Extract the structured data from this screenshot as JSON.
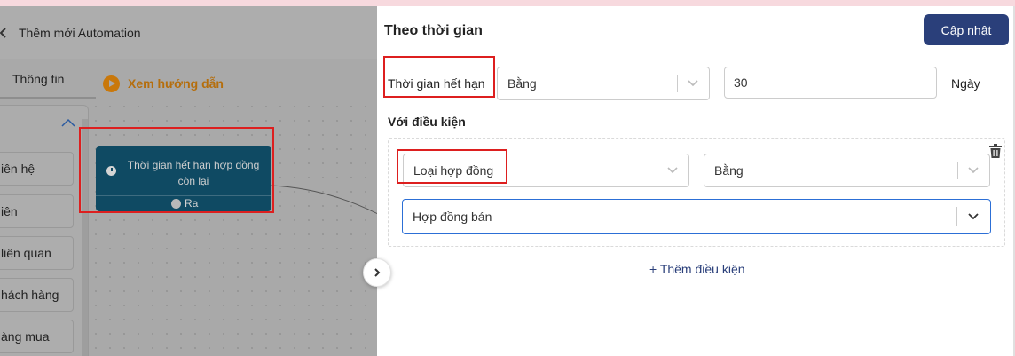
{
  "app": {
    "page_title": "Thêm mới Automation",
    "tab_info": "Thông tin",
    "guide_link": "Xem hướng dẫn",
    "sidebar_items": [
      "iên hệ",
      "iên",
      "liên quan",
      "hách hàng",
      "àng mua"
    ],
    "node": {
      "text": "Thời gian hết hạn hợp đồng còn lại",
      "output": "Ra"
    }
  },
  "drawer": {
    "title": "Theo thời gian",
    "update_button": "Cập nhật",
    "expiry": {
      "label": "Thời gian hết hạn",
      "operator": "Bằng",
      "value": "30",
      "unit": "Ngày"
    },
    "conditions_heading": "Với điều kiện",
    "condition": {
      "field": "Loại hợp đồng",
      "operator": "Bằng",
      "value": "Hợp đồng bán"
    },
    "add_condition": "+ Thêm điều kiện"
  },
  "colors": {
    "primary": "#2a3f7a",
    "highlight_border": "#dd1f1f",
    "focus_border": "#2c6fd6",
    "node_bg": "#0f4a63",
    "guide_accent": "#b56e0d"
  }
}
